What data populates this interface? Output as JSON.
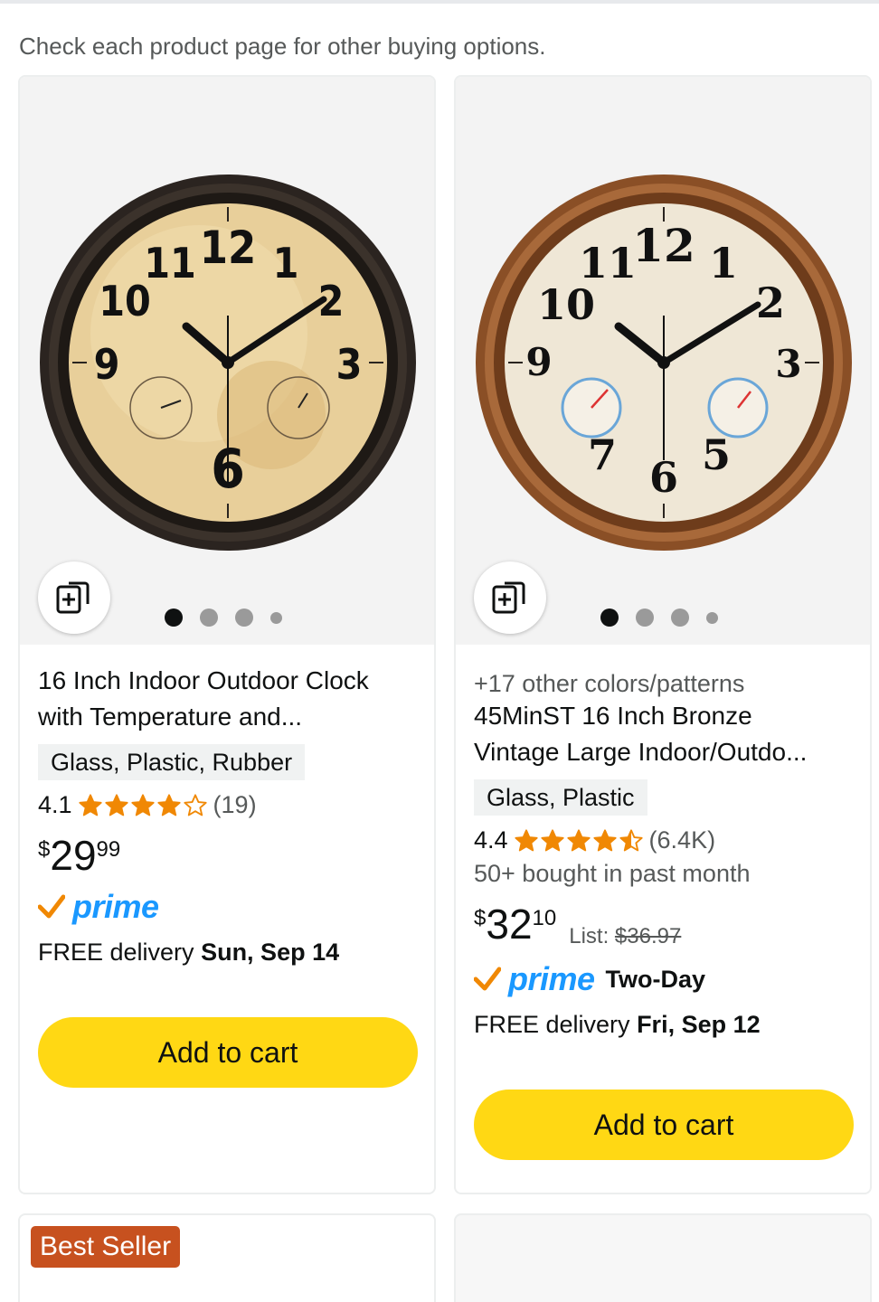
{
  "notice": "Check each product page for other buying options.",
  "colors": {
    "star": "#f08804",
    "prime": "#1a98ff",
    "add_to_cart": "#ffd814",
    "badge": "#c7511f"
  },
  "products": [
    {
      "image_pager": {
        "count": 4,
        "active": 0
      },
      "title_line1": "16 Inch Indoor Outdoor Clock",
      "title_line2": "with Temperature and...",
      "material": "Glass, Plastic, Rubber",
      "rating": "4.1",
      "rating_stars": 4.1,
      "review_count": "(19)",
      "price_symbol": "$",
      "price_whole": "29",
      "price_fraction": "99",
      "prime_label": "prime",
      "delivery_prefix": "FREE delivery ",
      "delivery_date": "Sun, Sep 14",
      "add_label": "Add to cart"
    },
    {
      "image_pager": {
        "count": 4,
        "active": 0
      },
      "variants": "+17 other colors/patterns",
      "title_line1": "45MinST 16 Inch Bronze",
      "title_line2": "Vintage Large Indoor/Outdo...",
      "material": "Glass, Plastic",
      "rating": "4.4",
      "rating_stars": 4.4,
      "review_count": "(6.4K)",
      "bought": "50+ bought in past month",
      "price_symbol": "$",
      "price_whole": "32",
      "price_fraction": "10",
      "list_label": "List: ",
      "list_price": "$36.97",
      "prime_label": "prime",
      "prime_speed": "Two-Day",
      "delivery_prefix": "FREE delivery ",
      "delivery_date": "Fri, Sep 12",
      "add_label": "Add to cart"
    }
  ],
  "next_row": {
    "badge": "Best Seller"
  }
}
